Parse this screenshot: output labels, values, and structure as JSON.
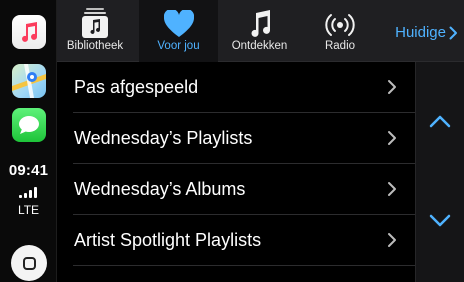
{
  "dock": {
    "apps": [
      {
        "name": "Music",
        "icon": "music-note-icon"
      },
      {
        "name": "Maps",
        "icon": "maps-icon"
      },
      {
        "name": "Messages",
        "icon": "message-bubble-icon"
      }
    ],
    "time": "09:41",
    "network": "LTE",
    "home_icon": "home-button-icon"
  },
  "tabs": [
    {
      "label": "Bibliotheek",
      "icon": "library-icon",
      "active": false
    },
    {
      "label": "Voor jou",
      "icon": "heart-icon",
      "active": true
    },
    {
      "label": "Ontdekken",
      "icon": "music-note-icon",
      "active": false
    },
    {
      "label": "Radio",
      "icon": "radio-waves-icon",
      "active": false
    }
  ],
  "now_playing": {
    "label": "Huidige",
    "icon": "chevron-right-icon"
  },
  "list": {
    "items": [
      {
        "label": "Pas afgespeeld"
      },
      {
        "label": "Wednesday’s Playlists"
      },
      {
        "label": "Wednesday’s Albums"
      },
      {
        "label": "Artist Spotlight Playlists"
      }
    ]
  },
  "scroll": {
    "up_icon": "chevron-up-icon",
    "down_icon": "chevron-down-icon"
  },
  "colors": {
    "accent": "#4fb2ff",
    "background": "#000000",
    "tabbar": "#1f1f22",
    "divider": "#2c2c2e",
    "music_icon": "#fb3c5c",
    "messages_icon": "#1ec439"
  }
}
